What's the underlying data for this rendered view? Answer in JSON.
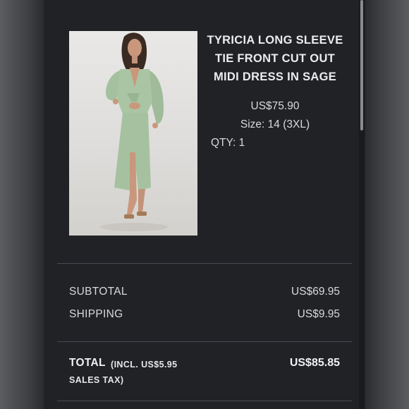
{
  "product": {
    "title_line1": "TYRICIA LONG SLEEVE",
    "title_line2": "TIE FRONT CUT OUT",
    "title_line3": "MIDI DRESS IN SAGE",
    "price": "US$75.90",
    "size": "Size: 14 (3XL)",
    "qty": "QTY: 1",
    "image_icon": "sage-midi-dress-photo"
  },
  "summary": {
    "subtotal_label": "SUBTOTAL",
    "subtotal_value": "US$69.95",
    "shipping_label": "SHIPPING",
    "shipping_value": "US$9.95",
    "total_label": "TOTAL",
    "total_note_line1": "(INCL. US$5.95",
    "total_note_line2": "SALES TAX)",
    "total_value": "US$85.85"
  },
  "colors": {
    "panel_background": "#212226",
    "dress": "#a8c3a2",
    "text": "#e4e4e6"
  }
}
